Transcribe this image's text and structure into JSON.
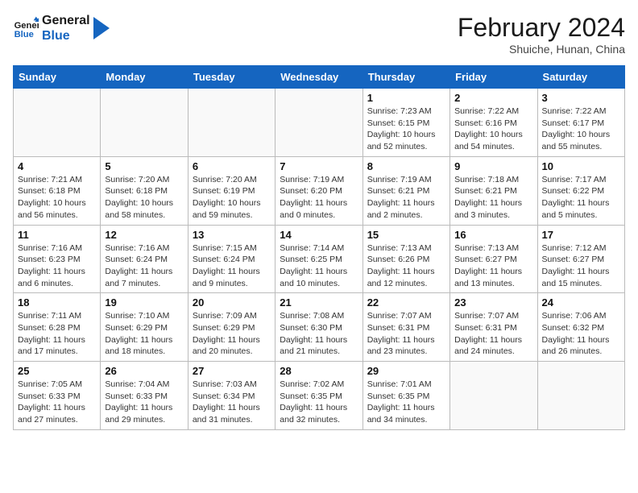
{
  "header": {
    "logo_general": "General",
    "logo_blue": "Blue",
    "title": "February 2024",
    "subtitle": "Shuiche, Hunan, China"
  },
  "days_of_week": [
    "Sunday",
    "Monday",
    "Tuesday",
    "Wednesday",
    "Thursday",
    "Friday",
    "Saturday"
  ],
  "weeks": [
    [
      {
        "day": "",
        "info": ""
      },
      {
        "day": "",
        "info": ""
      },
      {
        "day": "",
        "info": ""
      },
      {
        "day": "",
        "info": ""
      },
      {
        "day": "1",
        "info": "Sunrise: 7:23 AM\nSunset: 6:15 PM\nDaylight: 10 hours and 52 minutes."
      },
      {
        "day": "2",
        "info": "Sunrise: 7:22 AM\nSunset: 6:16 PM\nDaylight: 10 hours and 54 minutes."
      },
      {
        "day": "3",
        "info": "Sunrise: 7:22 AM\nSunset: 6:17 PM\nDaylight: 10 hours and 55 minutes."
      }
    ],
    [
      {
        "day": "4",
        "info": "Sunrise: 7:21 AM\nSunset: 6:18 PM\nDaylight: 10 hours and 56 minutes."
      },
      {
        "day": "5",
        "info": "Sunrise: 7:20 AM\nSunset: 6:18 PM\nDaylight: 10 hours and 58 minutes."
      },
      {
        "day": "6",
        "info": "Sunrise: 7:20 AM\nSunset: 6:19 PM\nDaylight: 10 hours and 59 minutes."
      },
      {
        "day": "7",
        "info": "Sunrise: 7:19 AM\nSunset: 6:20 PM\nDaylight: 11 hours and 0 minutes."
      },
      {
        "day": "8",
        "info": "Sunrise: 7:19 AM\nSunset: 6:21 PM\nDaylight: 11 hours and 2 minutes."
      },
      {
        "day": "9",
        "info": "Sunrise: 7:18 AM\nSunset: 6:21 PM\nDaylight: 11 hours and 3 minutes."
      },
      {
        "day": "10",
        "info": "Sunrise: 7:17 AM\nSunset: 6:22 PM\nDaylight: 11 hours and 5 minutes."
      }
    ],
    [
      {
        "day": "11",
        "info": "Sunrise: 7:16 AM\nSunset: 6:23 PM\nDaylight: 11 hours and 6 minutes."
      },
      {
        "day": "12",
        "info": "Sunrise: 7:16 AM\nSunset: 6:24 PM\nDaylight: 11 hours and 7 minutes."
      },
      {
        "day": "13",
        "info": "Sunrise: 7:15 AM\nSunset: 6:24 PM\nDaylight: 11 hours and 9 minutes."
      },
      {
        "day": "14",
        "info": "Sunrise: 7:14 AM\nSunset: 6:25 PM\nDaylight: 11 hours and 10 minutes."
      },
      {
        "day": "15",
        "info": "Sunrise: 7:13 AM\nSunset: 6:26 PM\nDaylight: 11 hours and 12 minutes."
      },
      {
        "day": "16",
        "info": "Sunrise: 7:13 AM\nSunset: 6:27 PM\nDaylight: 11 hours and 13 minutes."
      },
      {
        "day": "17",
        "info": "Sunrise: 7:12 AM\nSunset: 6:27 PM\nDaylight: 11 hours and 15 minutes."
      }
    ],
    [
      {
        "day": "18",
        "info": "Sunrise: 7:11 AM\nSunset: 6:28 PM\nDaylight: 11 hours and 17 minutes."
      },
      {
        "day": "19",
        "info": "Sunrise: 7:10 AM\nSunset: 6:29 PM\nDaylight: 11 hours and 18 minutes."
      },
      {
        "day": "20",
        "info": "Sunrise: 7:09 AM\nSunset: 6:29 PM\nDaylight: 11 hours and 20 minutes."
      },
      {
        "day": "21",
        "info": "Sunrise: 7:08 AM\nSunset: 6:30 PM\nDaylight: 11 hours and 21 minutes."
      },
      {
        "day": "22",
        "info": "Sunrise: 7:07 AM\nSunset: 6:31 PM\nDaylight: 11 hours and 23 minutes."
      },
      {
        "day": "23",
        "info": "Sunrise: 7:07 AM\nSunset: 6:31 PM\nDaylight: 11 hours and 24 minutes."
      },
      {
        "day": "24",
        "info": "Sunrise: 7:06 AM\nSunset: 6:32 PM\nDaylight: 11 hours and 26 minutes."
      }
    ],
    [
      {
        "day": "25",
        "info": "Sunrise: 7:05 AM\nSunset: 6:33 PM\nDaylight: 11 hours and 27 minutes."
      },
      {
        "day": "26",
        "info": "Sunrise: 7:04 AM\nSunset: 6:33 PM\nDaylight: 11 hours and 29 minutes."
      },
      {
        "day": "27",
        "info": "Sunrise: 7:03 AM\nSunset: 6:34 PM\nDaylight: 11 hours and 31 minutes."
      },
      {
        "day": "28",
        "info": "Sunrise: 7:02 AM\nSunset: 6:35 PM\nDaylight: 11 hours and 32 minutes."
      },
      {
        "day": "29",
        "info": "Sunrise: 7:01 AM\nSunset: 6:35 PM\nDaylight: 11 hours and 34 minutes."
      },
      {
        "day": "",
        "info": ""
      },
      {
        "day": "",
        "info": ""
      }
    ]
  ]
}
